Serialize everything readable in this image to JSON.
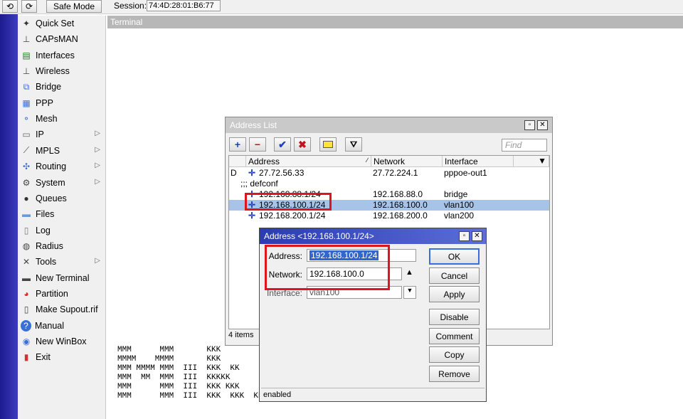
{
  "toolbar": {
    "undo_icon": "undo-icon",
    "redo_icon": "redo-icon",
    "safe_mode": "Safe Mode",
    "session_label": "Session:",
    "session_value": "74:4D:28:01:B6:77"
  },
  "menu": {
    "items": [
      {
        "label": "Quick Set",
        "icon": "wand-icon"
      },
      {
        "label": "CAPsMAN",
        "icon": "antenna-icon"
      },
      {
        "label": "Interfaces",
        "icon": "interfaces-icon"
      },
      {
        "label": "Wireless",
        "icon": "wireless-icon"
      },
      {
        "label": "Bridge",
        "icon": "bridge-icon"
      },
      {
        "label": "PPP",
        "icon": "ppp-icon"
      },
      {
        "label": "Mesh",
        "icon": "mesh-icon"
      },
      {
        "label": "IP",
        "icon": "ip-icon",
        "submenu": true
      },
      {
        "label": "MPLS",
        "icon": "mpls-icon",
        "submenu": true
      },
      {
        "label": "Routing",
        "icon": "routing-icon",
        "submenu": true
      },
      {
        "label": "System",
        "icon": "system-icon",
        "submenu": true
      },
      {
        "label": "Queues",
        "icon": "queues-icon"
      },
      {
        "label": "Files",
        "icon": "folder-icon"
      },
      {
        "label": "Log",
        "icon": "log-icon"
      },
      {
        "label": "Radius",
        "icon": "radius-icon"
      },
      {
        "label": "Tools",
        "icon": "tools-icon",
        "submenu": true
      },
      {
        "label": "New Terminal",
        "icon": "terminal-icon"
      },
      {
        "label": "Partition",
        "icon": "partition-icon"
      },
      {
        "label": "Make Supout.rif",
        "icon": "document-icon"
      },
      {
        "label": "Manual",
        "icon": "help-icon"
      },
      {
        "label": "New WinBox",
        "icon": "winbox-icon"
      },
      {
        "label": "Exit",
        "icon": "exit-icon"
      }
    ]
  },
  "terminal": {
    "title": "Terminal",
    "lines": [
      "MMM      MMM       KKK",
      "MMMM    MMMM       KKK",
      "MMM MMMM MMM  III  KKK  KK",
      "MMM  MM  MMM  III  KKKKK",
      "MMM      MMM  III  KKK KKK",
      "MMM      MMM  III  KKK  KKK  KKK  KKK  000000     III     III  KKK  KKK"
    ]
  },
  "address_list": {
    "title": "Address List",
    "find_placeholder": "Find",
    "columns": [
      "Address",
      "Network",
      "Interface"
    ],
    "rows": [
      {
        "flag": "D",
        "address": "27.72.56.33",
        "network": "27.72.224.1",
        "interface": "pppoe-out1"
      },
      {
        "comment": ";;; defconf"
      },
      {
        "flag": "",
        "address": "192.168.88.1/24",
        "network": "192.168.88.0",
        "interface": "bridge"
      },
      {
        "flag": "",
        "address": "192.168.100.1/24",
        "network": "192.168.100.0",
        "interface": "vlan100",
        "selected": true
      },
      {
        "flag": "",
        "address": "192.168.200.1/24",
        "network": "192.168.200.0",
        "interface": "vlan200"
      }
    ],
    "status": "4 items"
  },
  "address_dialog": {
    "title": "Address <192.168.100.1/24>",
    "address_label": "Address:",
    "address_value": "192.168.100.1/24",
    "network_label": "Network:",
    "network_value": "192.168.100.0",
    "interface_label": "Interface:",
    "interface_value": "vlan100",
    "buttons": {
      "ok": "OK",
      "cancel": "Cancel",
      "apply": "Apply",
      "disable": "Disable",
      "comment": "Comment",
      "copy": "Copy",
      "remove": "Remove"
    },
    "status": "enabled"
  },
  "colors": {
    "highlight_red": "#e0141d",
    "selection_blue": "#a7c4e8",
    "dialog_title_blue": "#2c3cb0"
  }
}
